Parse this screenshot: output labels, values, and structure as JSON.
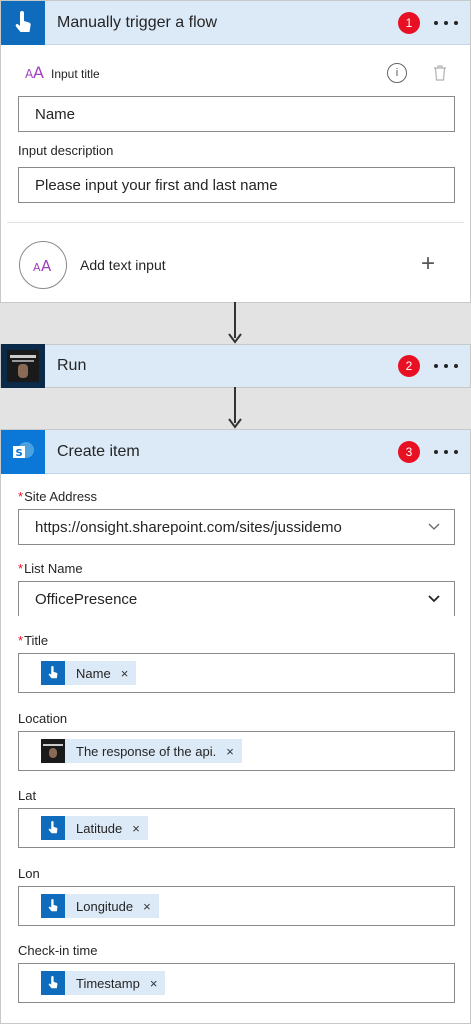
{
  "trigger": {
    "title": "Manually trigger a flow",
    "badge": "1",
    "input_title_label": "Input title",
    "name_value": "Name",
    "input_description_label": "Input description",
    "description_value": "Please input your first and last name",
    "add_text_input_label": "Add text input",
    "add_icon": "+"
  },
  "run": {
    "title": "Run",
    "badge": "2"
  },
  "create": {
    "title": "Create item",
    "badge": "3",
    "site_address_label": "Site Address",
    "site_address_value": "https://onsight.sharepoint.com/sites/jussidemo",
    "list_name_label": "List Name",
    "list_name_value": "OfficePresence",
    "title_label": "Title",
    "title_token": "Name",
    "location_label": "Location",
    "location_token": "The response of the api.",
    "lat_label": "Lat",
    "lat_token": "Latitude",
    "lon_label": "Lon",
    "lon_token": "Longitude",
    "checkin_label": "Check-in time",
    "checkin_token": "Timestamp",
    "required_mark": "*",
    "remove_mark": "×"
  },
  "icons": {
    "trigger": "touch-hand-icon",
    "sharepoint": "sharepoint-icon",
    "text": "text-aa-icon",
    "info": "info-icon",
    "trash": "trash-icon"
  }
}
